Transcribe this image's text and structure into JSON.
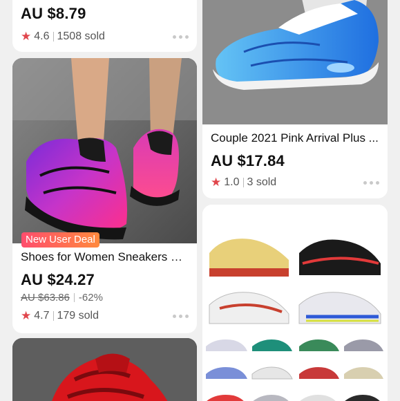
{
  "left_column": {
    "card1": {
      "price": "AU $8.79",
      "rating": "4.6",
      "sold": "1508 sold"
    },
    "card2": {
      "badge": "New User Deal",
      "title": "Shoes for Women Sneakers M...",
      "price": "AU $24.27",
      "old_price": "AU $63.86",
      "discount": "-62%",
      "rating": "4.7",
      "sold": "179 sold"
    }
  },
  "right_column": {
    "card1": {
      "title": "Couple 2021 Pink Arrival Plus ...",
      "price": "AU $17.84",
      "rating": "1.0",
      "sold": "3 sold"
    }
  },
  "icons": {
    "rating": "star-icon",
    "more": "more-dots-icon"
  },
  "colors": {
    "star": "#e0464c",
    "badge_start": "#ff4d6d",
    "badge_end": "#ff8a3d",
    "background": "#f0f0f0",
    "card": "#ffffff"
  }
}
